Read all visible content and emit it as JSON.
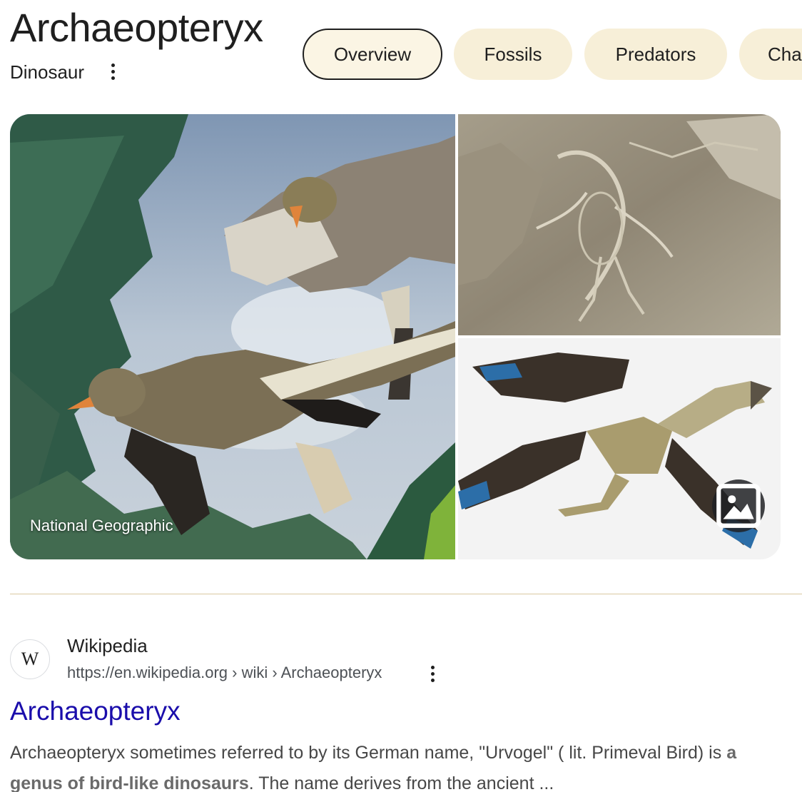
{
  "header": {
    "title": "Archaeopteryx",
    "subtitle": "Dinosaur"
  },
  "tabs": [
    {
      "label": "Overview",
      "active": true
    },
    {
      "label": "Fossils",
      "active": false
    },
    {
      "label": "Predators",
      "active": false
    },
    {
      "label": "Cha",
      "active": false
    }
  ],
  "gallery": {
    "main_image_source": "National Geographic",
    "images_button_icon": "image-icon"
  },
  "result": {
    "favicon_letter": "W",
    "site_name": "Wikipedia",
    "url": "https://en.wikipedia.org › wiki › Archaeopteryx",
    "title": "Archaeopteryx",
    "snippet_part1": "Archaeopteryx sometimes referred to by its German name, \"Urvogel\" ( lit. Primeval Bird) is ",
    "snippet_emphasis": "a genus of bird-like dinosaurs",
    "snippet_part2": ". The name derives from the ancient ..."
  },
  "colors": {
    "chip_bg": "#f7efd8",
    "link": "#1a0dab",
    "divider": "#d9c9a0"
  }
}
